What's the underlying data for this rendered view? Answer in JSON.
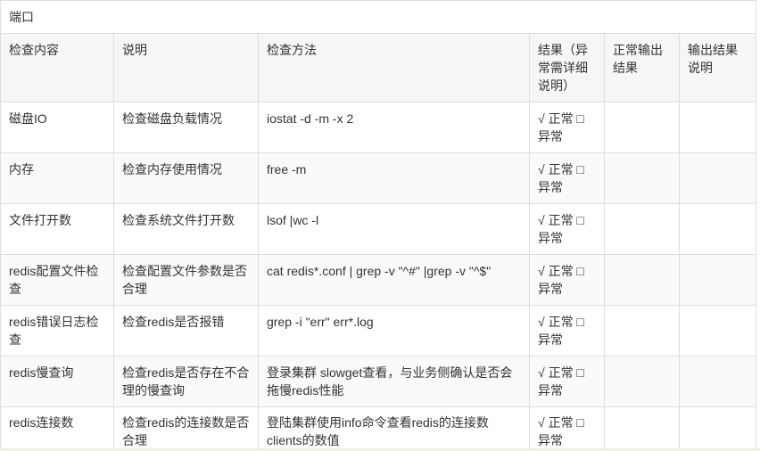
{
  "table": {
    "title": "端口",
    "headers": {
      "check_item": "检查内容",
      "description": "说明",
      "method": "检查方法",
      "result": "结果（异常需详细说明）",
      "normal_output": "正常输出结果",
      "output_note": "输出结果说明"
    },
    "rows": [
      {
        "check_item": "磁盘IO",
        "description": "检查磁盘负载情况",
        "method": "iostat -d -m -x 2",
        "result": "√ 正常 □ 异常"
      },
      {
        "check_item": "内存",
        "description": "检查内存使用情况",
        "method": "free -m",
        "result": "√ 正常 □ 异常"
      },
      {
        "check_item": "文件打开数",
        "description": "检查系统文件打开数",
        "method": "lsof |wc -l",
        "result": "√ 正常 □ 异常"
      },
      {
        "check_item": "redis配置文件检查",
        "description": "检查配置文件参数是否合理",
        "method": "cat redis*.conf | grep -v \"^#\" |grep -v \"^$\"",
        "result": "√ 正常 □ 异常"
      },
      {
        "check_item": "redis错误日志检查",
        "description": "检查redis是否报错",
        "method": "grep -i \"err\" err*.log",
        "result": "√ 正常 □ 异常"
      },
      {
        "check_item": "redis慢查询",
        "description": "检查redis是否存在不合理的慢查询",
        "method": "登录集群 slowget查看，与业务侧确认是否会拖慢redis性能",
        "result": "√ 正常 □ 异常"
      },
      {
        "check_item": "redis连接数",
        "description": "检查redis的连接数是否合理",
        "method": "登陆集群使用info命令查看redis的连接数clients的数值",
        "result": "√ 正常 □ 异常"
      }
    ]
  },
  "colors": {
    "border": "#dddddd",
    "header_background": "#f6f6f6",
    "stripe_background": "#fafafa",
    "text": "#333333",
    "bottom_strip": "#eef4dc"
  }
}
